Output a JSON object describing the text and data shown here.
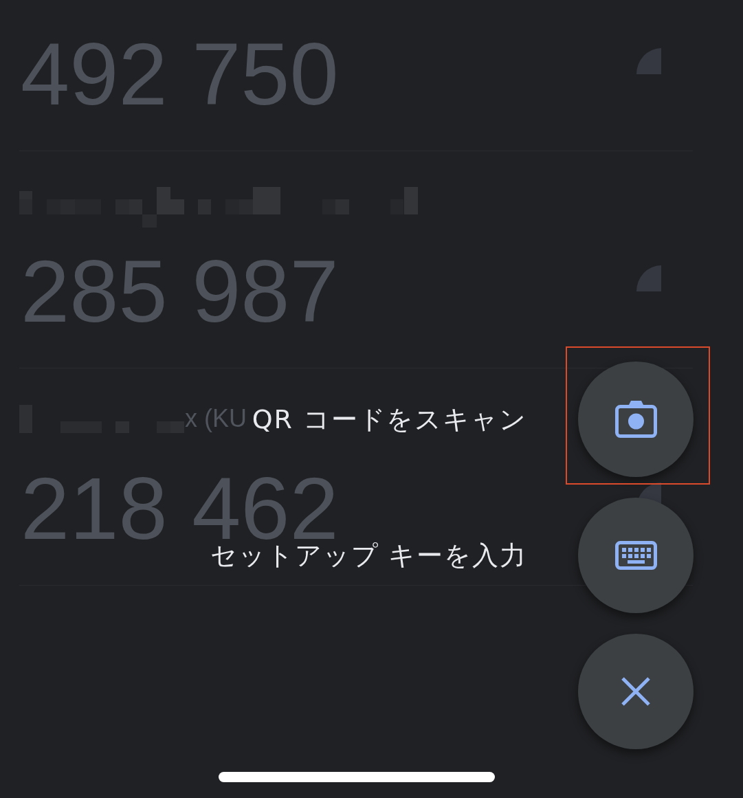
{
  "accounts": [
    {
      "code": "492 750"
    },
    {
      "label": {
        "kind": "pixelated"
      },
      "code": "285 987"
    },
    {
      "label": {
        "kind": "pixelated",
        "visible_text": "x (KU"
      },
      "code": "218 462"
    }
  ],
  "speed_dial": {
    "actions": [
      {
        "kind": "scan-qr",
        "label": "QR コードをスキャン",
        "highlighted": true
      },
      {
        "kind": "enter-key",
        "label": "セットアップ キーを入力",
        "highlighted": false
      },
      {
        "kind": "close",
        "highlighted": false
      }
    ]
  }
}
